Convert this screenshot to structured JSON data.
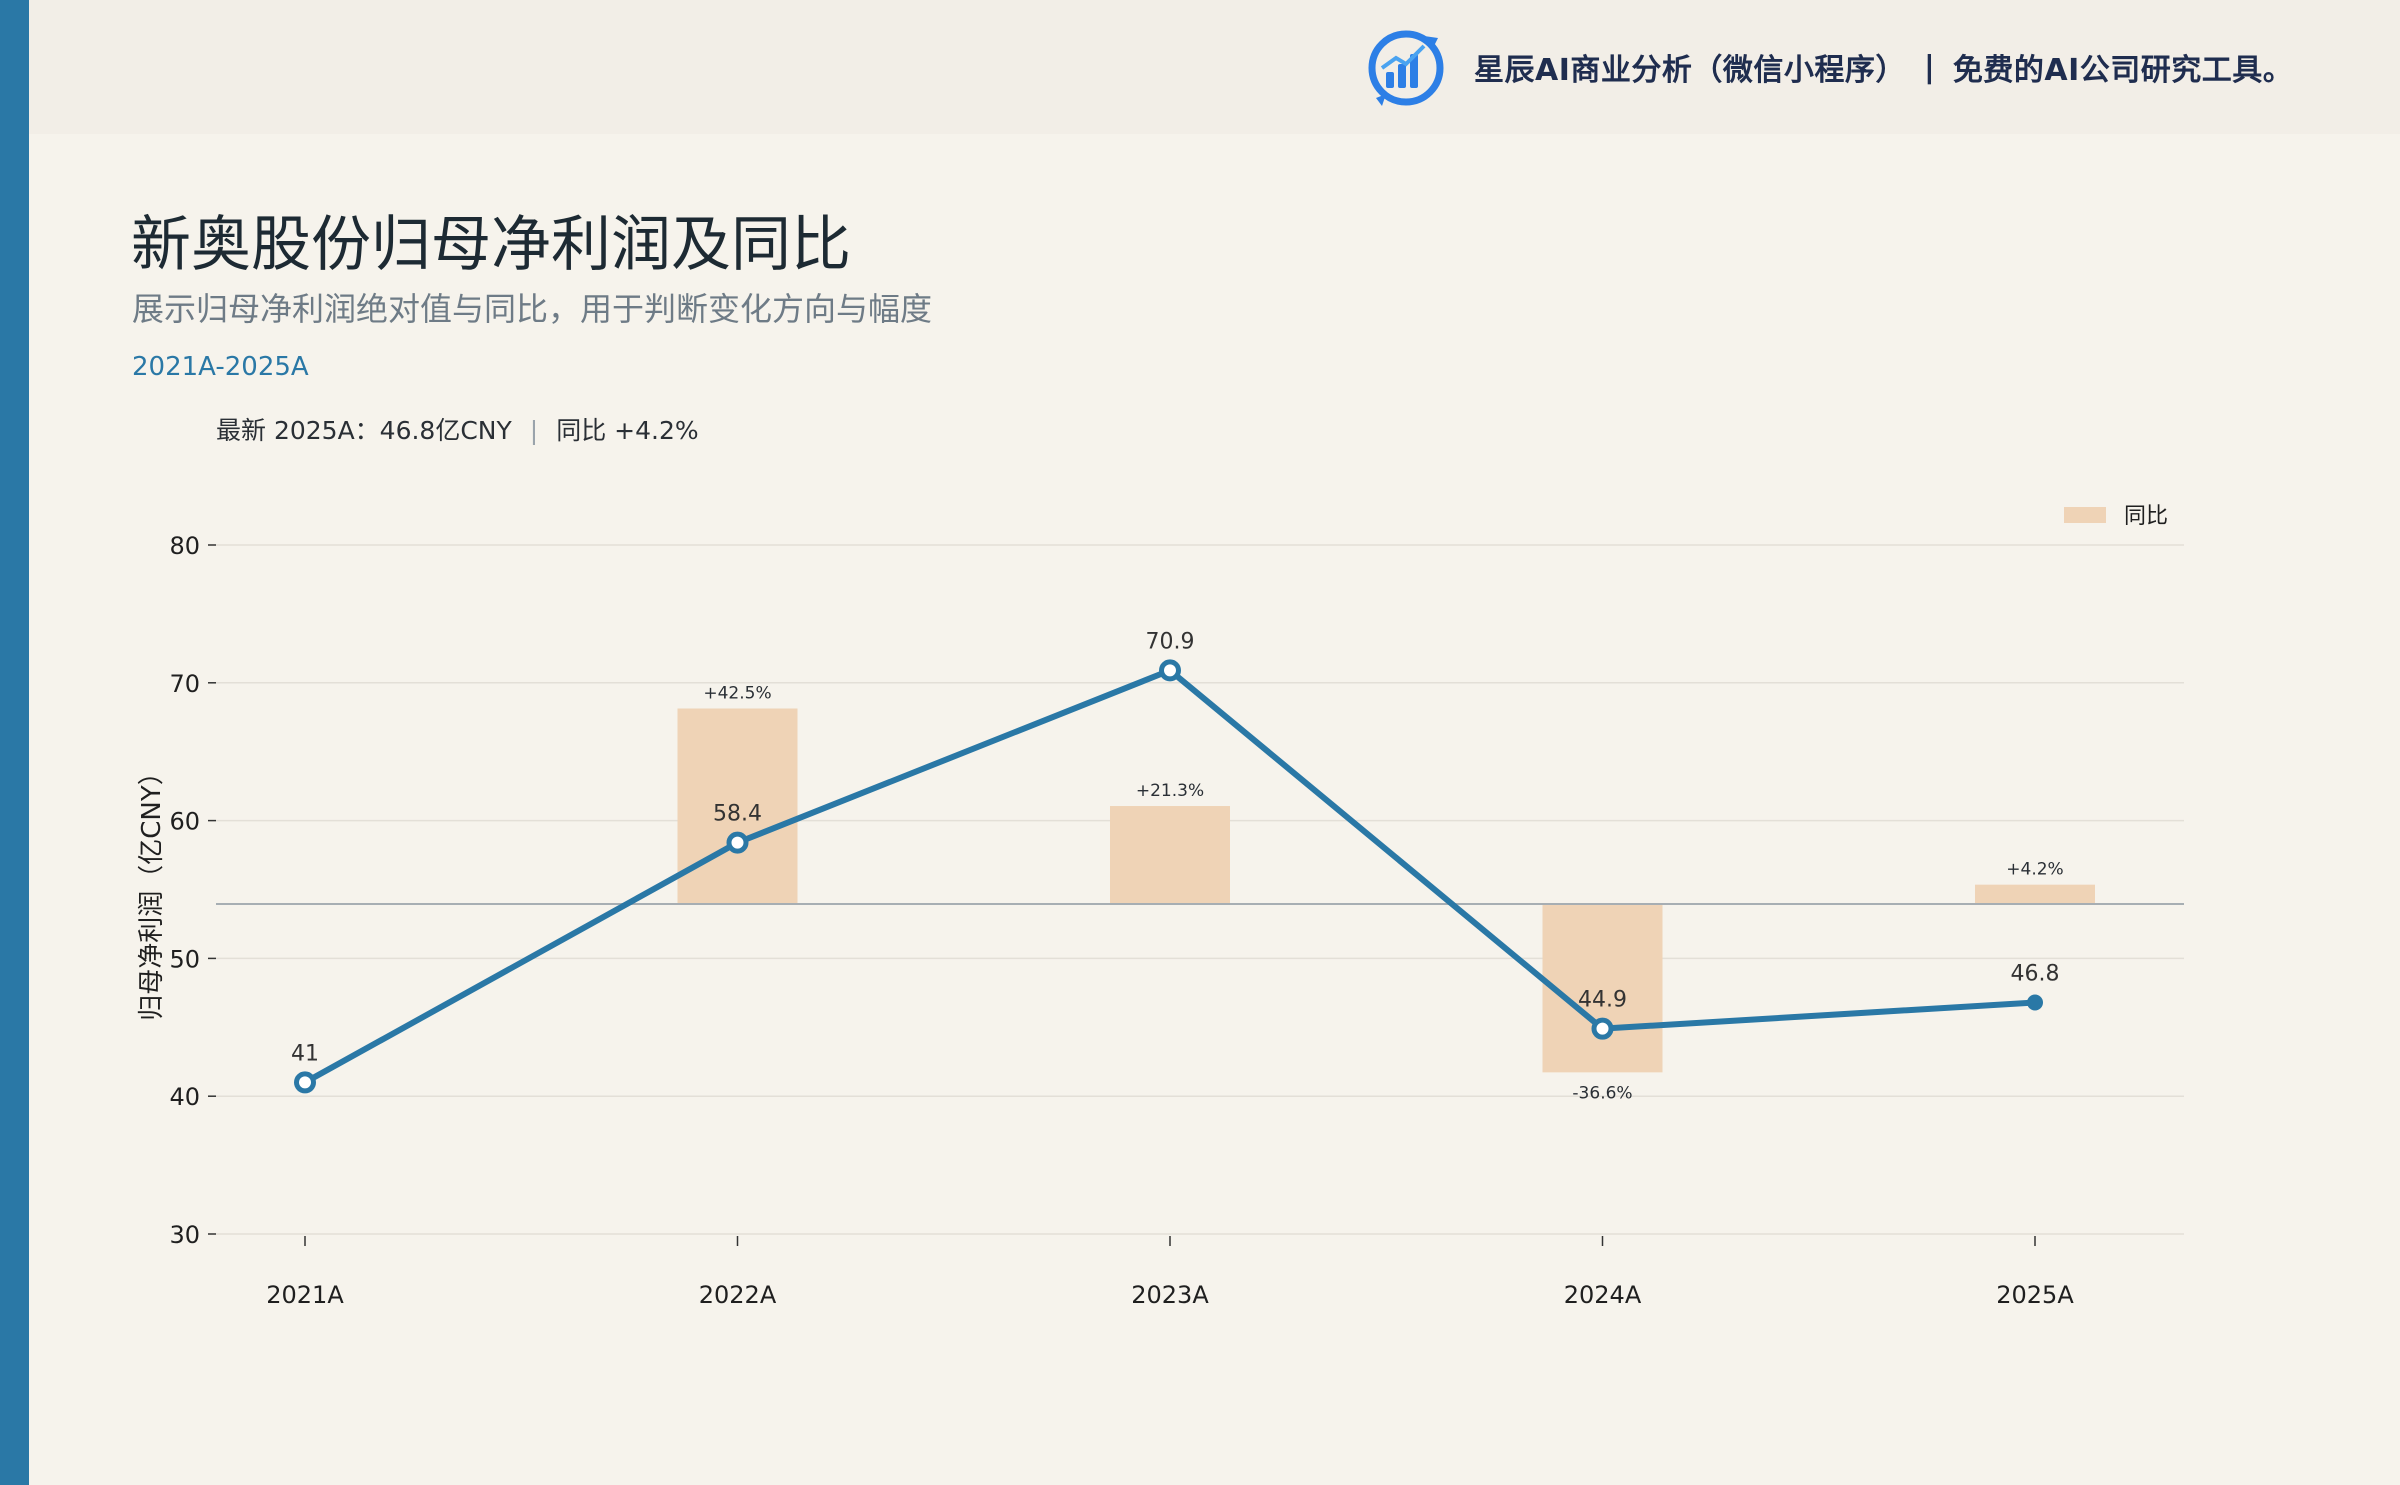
{
  "header": {
    "brand_name": "星辰AI商业分析（微信小程序）",
    "separator": "|",
    "brand_slogan": "免费的AI公司研究工具。"
  },
  "title": "新奥股份归母净利润及同比",
  "subtitle": "展示归母净利润绝对值与同比，用于判断变化方向与幅度",
  "range": "2021A-2025A",
  "kpi": {
    "latest": "最新 2025A：46.8亿CNY",
    "sep": "|",
    "yoy": "同比 +4.2%"
  },
  "colors": {
    "accent": "#2a78a6",
    "bar": "#efd3b6",
    "background": "#f6f3ec"
  },
  "chart_data": {
    "type": "bar+line",
    "categories": [
      "2021A",
      "2022A",
      "2023A",
      "2024A",
      "2025A"
    ],
    "ylabel": "归母净利润（亿CNY）",
    "ylim": [
      30,
      80
    ],
    "yticks": [
      30,
      40,
      50,
      60,
      70,
      80
    ],
    "grid": true,
    "legend_position": "top-right",
    "series": [
      {
        "type": "line",
        "values": [
          41,
          58.4,
          70.9,
          44.9,
          46.8
        ],
        "value_labels": [
          "41",
          "58.4",
          "70.9",
          "44.9",
          "46.8"
        ]
      },
      {
        "name": "同比",
        "type": "bar",
        "values": [
          null,
          42.5,
          21.3,
          -36.6,
          4.2
        ],
        "value_labels": [
          "",
          "+42.5%",
          "+21.3%",
          "-36.6%",
          "+4.2%"
        ]
      }
    ]
  }
}
